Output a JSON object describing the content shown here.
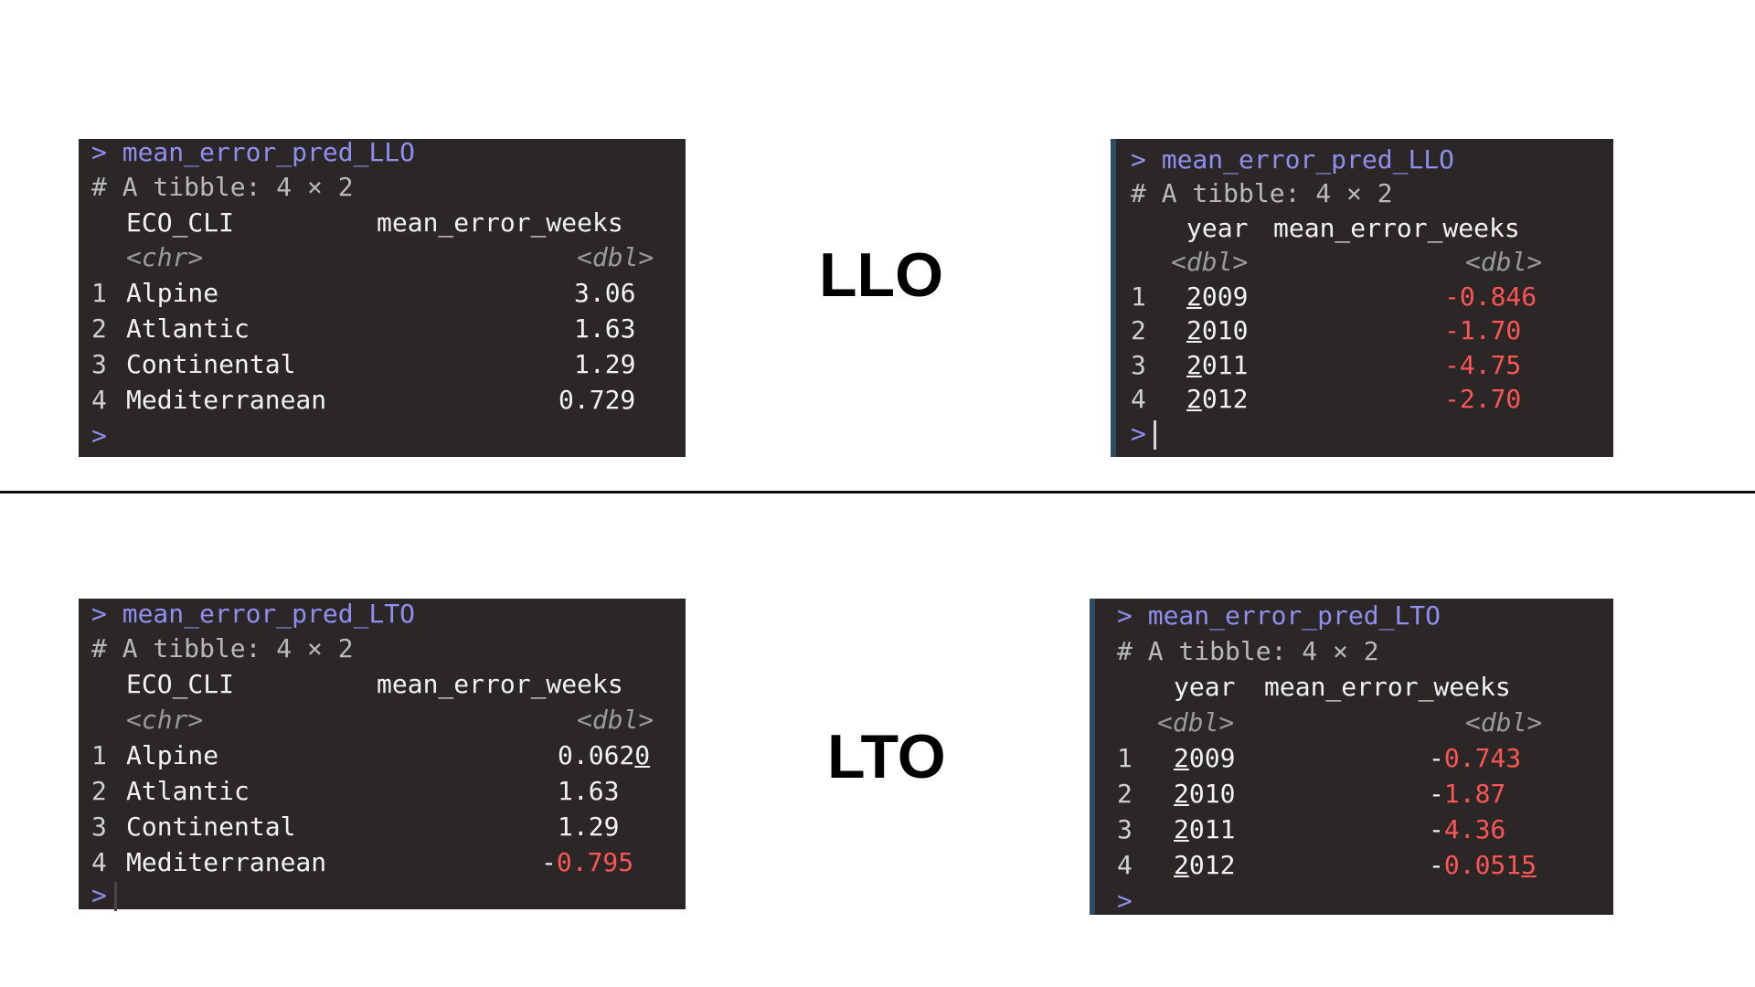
{
  "labels": {
    "top": "LLO",
    "bottom": "LTO"
  },
  "panels": {
    "llo_eco": {
      "prompt": ">",
      "command": "mean_error_pred_LLO",
      "comment": "# A tibble: 4 × 2",
      "columns": [
        "ECO_CLI",
        "mean_error_weeks"
      ],
      "types": [
        "<chr>",
        "<dbl>"
      ],
      "rows": [
        {
          "n": "1",
          "key": "Alpine",
          "val": "3.06"
        },
        {
          "n": "2",
          "key": "Atlantic",
          "val": "1.63"
        },
        {
          "n": "3",
          "key": "Continental",
          "val": "1.29"
        },
        {
          "n": "4",
          "key": "Mediterranean",
          "val": "0.729"
        }
      ],
      "end_prompt": ">"
    },
    "llo_year": {
      "prompt": ">",
      "command": "mean_error_pred_LLO",
      "comment": "# A tibble: 4 × 2",
      "columns": [
        "year",
        "mean_error_weeks"
      ],
      "types": [
        "<dbl>",
        "<dbl>"
      ],
      "rows": [
        {
          "n": "1",
          "key_first": "2",
          "key_rest": "009",
          "val_sign": "-",
          "val": "0.846"
        },
        {
          "n": "2",
          "key_first": "2",
          "key_rest": "010",
          "val_sign": "-",
          "val": "1.70"
        },
        {
          "n": "3",
          "key_first": "2",
          "key_rest": "011",
          "val_sign": "-",
          "val": "4.75"
        },
        {
          "n": "4",
          "key_first": "2",
          "key_rest": "012",
          "val_sign": "-",
          "val": "2.70"
        }
      ],
      "end_prompt": ">"
    },
    "lto_eco": {
      "prompt": ">",
      "command": "mean_error_pred_LTO",
      "comment": "# A tibble: 4 × 2",
      "columns": [
        "ECO_CLI",
        "mean_error_weeks"
      ],
      "types": [
        "<chr>",
        "<dbl>"
      ],
      "rows": [
        {
          "n": "1",
          "key": "Alpine",
          "val_main": "0.062",
          "val_u": "0"
        },
        {
          "n": "2",
          "key": "Atlantic",
          "val": "1.63"
        },
        {
          "n": "3",
          "key": "Continental",
          "val": "1.29"
        },
        {
          "n": "4",
          "key": "Mediterranean",
          "val_sign": "-",
          "val": "0.795"
        }
      ],
      "end_prompt": ">"
    },
    "lto_year": {
      "prompt": ">",
      "command": "mean_error_pred_LTO",
      "comment": "# A tibble: 4 × 2",
      "columns": [
        "year",
        "mean_error_weeks"
      ],
      "types": [
        "<dbl>",
        "<dbl>"
      ],
      "rows": [
        {
          "n": "1",
          "key_first": "2",
          "key_rest": "009",
          "val_sign": "-",
          "val": "0.743"
        },
        {
          "n": "2",
          "key_first": "2",
          "key_rest": "010",
          "val_sign": "-",
          "val": "1.87"
        },
        {
          "n": "3",
          "key_first": "2",
          "key_rest": "011",
          "val_sign": "-",
          "val": "4.36"
        },
        {
          "n": "4",
          "key_first": "2",
          "key_rest": "012",
          "val_sign": "-",
          "val_main": "0.051",
          "val_u": "5"
        }
      ],
      "end_prompt": ">"
    }
  }
}
